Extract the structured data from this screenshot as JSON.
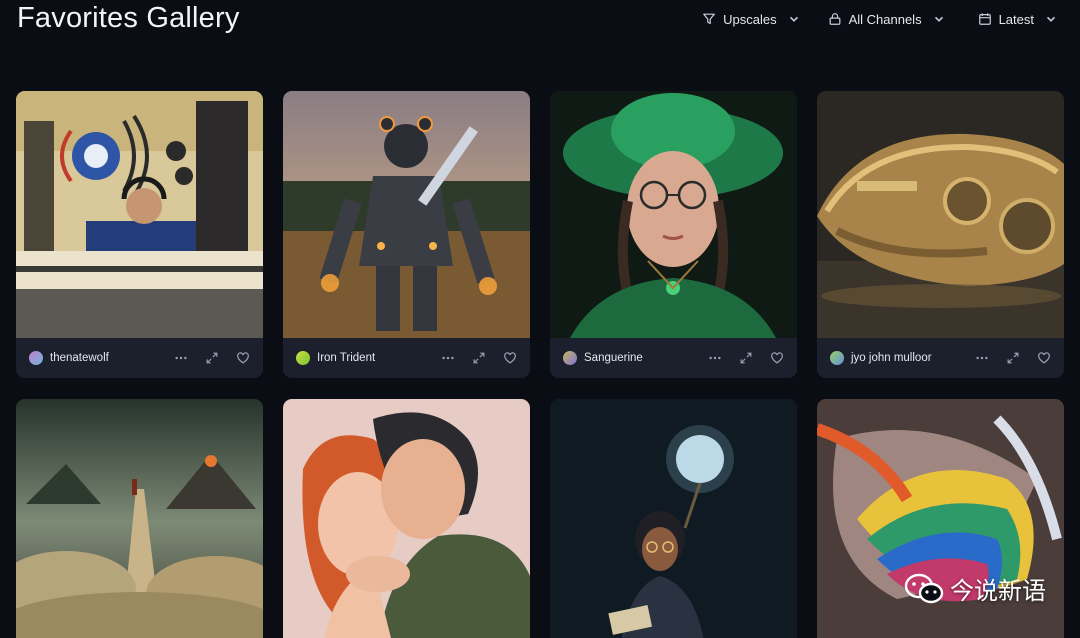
{
  "header": {
    "title": "Favorites Gallery"
  },
  "filters": [
    {
      "label": "Upscales",
      "icon": "filter-icon"
    },
    {
      "label": "All Channels",
      "icon": "lock-icon"
    },
    {
      "label": "Latest",
      "icon": "calendar-icon"
    }
  ],
  "cards": [
    {
      "user": "thenatewolf",
      "avatar": "#c77dd1"
    },
    {
      "user": "Iron Trident",
      "avatar": "#a6d23c"
    },
    {
      "user": "Sanguerine",
      "avatar": "#9b8bd8"
    },
    {
      "user": "jyo john mulloor",
      "avatar": "#7fb2c9"
    },
    {
      "user": "",
      "avatar": ""
    },
    {
      "user": "",
      "avatar": ""
    },
    {
      "user": "",
      "avatar": ""
    },
    {
      "user": "",
      "avatar": ""
    }
  ],
  "watermark": {
    "text": "今说新语"
  },
  "colors": {
    "background": "#0b0d14",
    "card": "#1c1f2c"
  }
}
